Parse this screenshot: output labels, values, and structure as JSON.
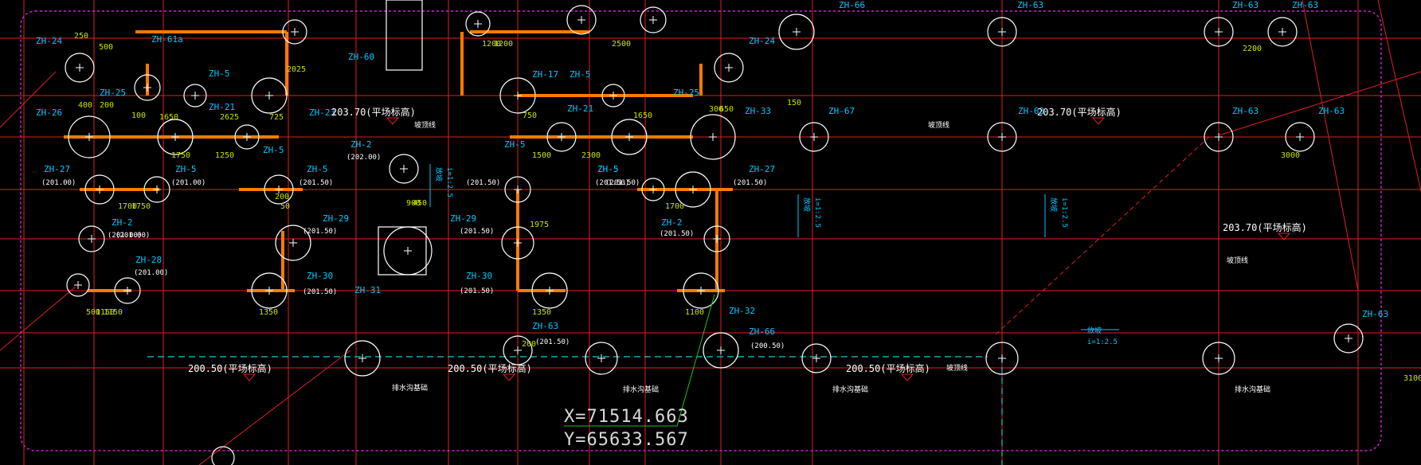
{
  "colors": {
    "background": "#000000",
    "grid_line": "#e02020",
    "boundary": "#d020d0",
    "beam": "#ff7a00",
    "cap_outline": "#ffffff",
    "label": "#00c8ff",
    "dimension": "#c8e000",
    "elevation": "#ffffff",
    "leader": "#20c020",
    "ramp_line": "#20c8c8"
  },
  "coordinate_readout": {
    "x": "X=71514.663",
    "y": "Y=65633.567"
  },
  "elevation_notes": [
    {
      "id": "e1",
      "text": "203.70(平场标高)"
    },
    {
      "id": "e2",
      "text": "203.70(平场标高)"
    },
    {
      "id": "e3",
      "text": "203.70(平场标高)"
    },
    {
      "id": "e4",
      "text": "200.50(平场标高)"
    },
    {
      "id": "e5",
      "text": "200.50(平场标高)"
    },
    {
      "id": "e6",
      "text": "200.50(平场标高)"
    }
  ],
  "pile_labels": [
    "ZH-24",
    "ZH-61a",
    "ZH-5",
    "ZH-25",
    "ZH-21",
    "ZH-26",
    "ZH-23",
    "ZH-60",
    "ZH-5",
    "ZH-27",
    "ZH-5",
    "ZH-2",
    "ZH-28",
    "ZH-5",
    "ZH-29",
    "ZH-30",
    "ZH-31",
    "ZH-2",
    "ZH-17",
    "ZH-5",
    "ZH-21",
    "ZH-5",
    "ZH-5",
    "ZH-29",
    "ZH-30",
    "ZH-63",
    "ZH-24",
    "ZH-25",
    "ZH-33",
    "ZH-27",
    "ZH-5",
    "ZH-2",
    "ZH-32",
    "ZH-66",
    "ZH-66",
    "ZH-67",
    "ZH-63",
    "ZH-63",
    "ZH-63",
    "ZH-63",
    "ZH-63",
    "ZH-63",
    "ZH-63"
  ],
  "elevation_tags": [
    "(201.00)",
    "(201.00)",
    "(201.00)",
    "(201.00)",
    "(201.50)",
    "(201.50)",
    "(201.50)",
    "(202.00)",
    "(201.50)",
    "(201.50)",
    "(201.50)",
    "(201.50)",
    "(201.50)",
    "(201.00)",
    "(201.50)",
    "(200.50)",
    "(201.50)",
    "(201.50)"
  ],
  "dimensions": [
    "250",
    "500",
    "200",
    "100",
    "1650",
    "2625",
    "725",
    "2025",
    "1150",
    "1250",
    "1750",
    "1700",
    "1750",
    "1350",
    "500",
    "1150",
    "200",
    "400",
    "900",
    "1500",
    "2300",
    "1700",
    "1100",
    "1975",
    "2200",
    "2500",
    "1200",
    "1650",
    "750",
    "300",
    "650",
    "450",
    "3000",
    "3100",
    "200",
    "150",
    "50",
    "1200",
    "1350"
  ],
  "ramp_notes": [
    {
      "text": "放坡",
      "slope": "i=1:2.5"
    },
    {
      "text": "放坡",
      "slope": "i=1:2.5"
    },
    {
      "text": "放坡",
      "slope": "i=1:2.5"
    },
    {
      "text": "放坡",
      "slope": "i=1:2.5"
    }
  ],
  "other_notes": [
    "坡顶线",
    "坡顶线",
    "坡顶线",
    "坡顶线",
    "排水沟基础",
    "排水沟基础",
    "排水沟基础",
    "排水沟基础"
  ]
}
